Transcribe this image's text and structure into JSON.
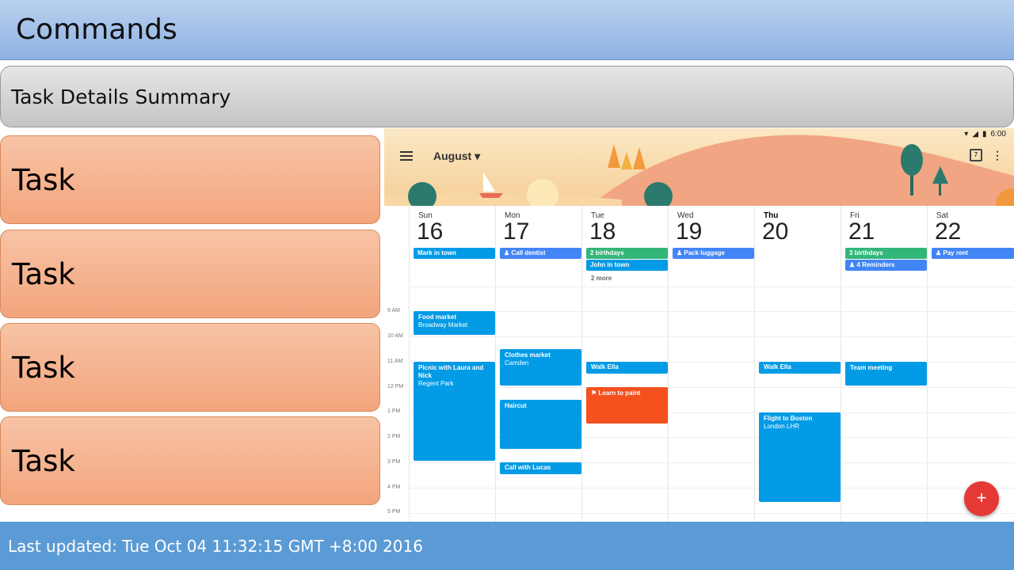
{
  "header": {
    "title": "Commands"
  },
  "summary": {
    "title": "Task Details Summary"
  },
  "tasks": [
    {
      "label": "Task"
    },
    {
      "label": "Task"
    },
    {
      "label": "Task"
    },
    {
      "label": "Task"
    }
  ],
  "footer": {
    "last_updated": "Last updated: Tue Oct 04 11:32:15 GMT +8:00 2016"
  },
  "calendar": {
    "status_time": "6:00",
    "month": "August",
    "month_caret": "▾",
    "icon_date": "7",
    "days": [
      {
        "name": "Sun",
        "num": "16"
      },
      {
        "name": "Mon",
        "num": "17"
      },
      {
        "name": "Tue",
        "num": "18"
      },
      {
        "name": "Wed",
        "num": "19"
      },
      {
        "name": "Thu",
        "num": "20"
      },
      {
        "name": "Fri",
        "num": "21"
      },
      {
        "name": "Sat",
        "num": "22"
      }
    ],
    "all_day": {
      "mark_in_town": "Mark in town",
      "call_dentist": "♟ Call dentist",
      "two_birthdays": "2 birthdays",
      "john_in_town": "John in town",
      "two_more": "2 more",
      "pack_luggage": "♟ Pack luggage",
      "three_birthdays": "3 birthdays",
      "four_reminders": "♟ 4 Reminders",
      "pay_rent": "♟ Pay rent"
    },
    "times": [
      "9 AM",
      "10 AM",
      "11 AM",
      "12 PM",
      "1 PM",
      "2 PM",
      "3 PM",
      "4 PM",
      "5 PM"
    ],
    "events": {
      "food_market": {
        "title": "Food market",
        "place": "Broadway Market"
      },
      "picnic": {
        "title": "Picnic with Laura and Nick",
        "place": "Regent Park"
      },
      "clothes_market": {
        "title": "Clothes market",
        "place": "Camden"
      },
      "haircut": {
        "title": "Haircut"
      },
      "call_lucas": {
        "title": "Call with Lucas"
      },
      "walk_ella_tue": {
        "title": "Walk Ella"
      },
      "learn_paint": {
        "title": "⚑ Learn to paint"
      },
      "walk_ella_thu": {
        "title": "Walk Ella"
      },
      "flight_boston": {
        "title": "Flight to Boston",
        "place": "London LHR"
      },
      "team_meeting": {
        "title": "Team meeting"
      }
    },
    "fab_label": "+",
    "colors": {
      "blue": "#039be5",
      "indigo": "#4285f4",
      "green": "#33b679",
      "orange": "#f4511e",
      "fab": "#e53935"
    }
  }
}
